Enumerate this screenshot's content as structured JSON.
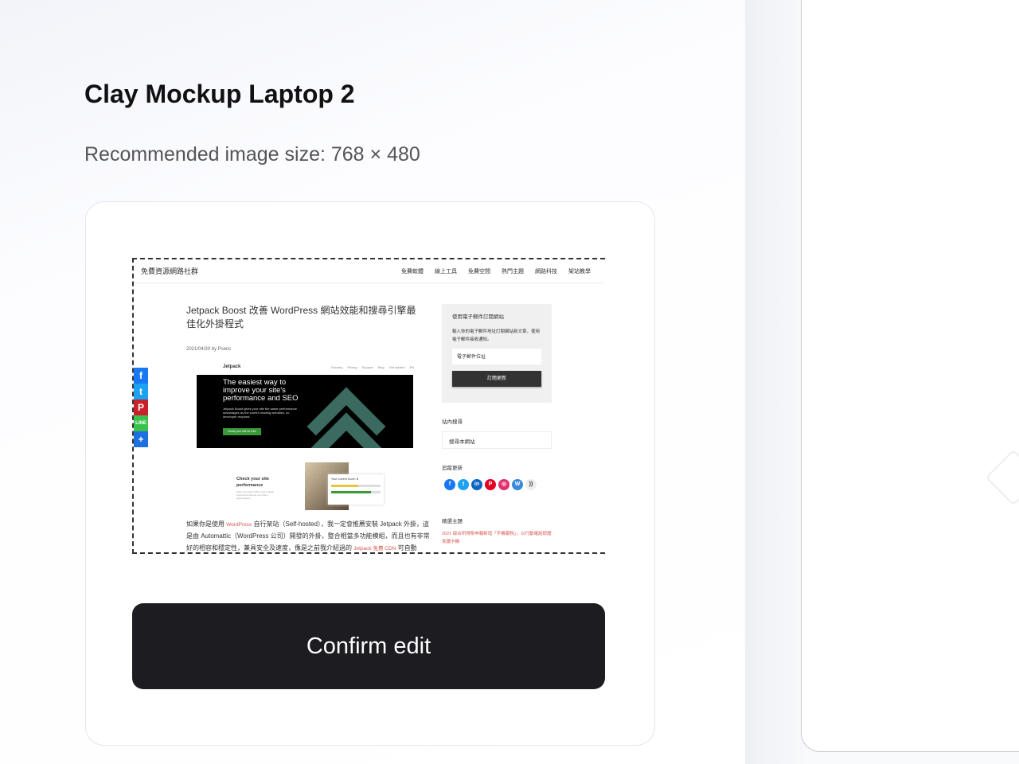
{
  "header": {
    "title": "Clay Mockup Laptop 2",
    "recommended": "Recommended image size: 768 × 480"
  },
  "preview": {
    "site_name": "免費資源網路社群",
    "nav": [
      "免費軟體",
      "線上工具",
      "免費空間",
      "熱門主題",
      "網路科技",
      "架站教學"
    ],
    "post_title": "Jetpack Boost 改善 WordPress 網站效能和搜尋引擎最佳化外掛程式",
    "meta": "2021/04/30 by Pseric",
    "jetpack": {
      "logo": "Jetpack",
      "nav": [
        "Security",
        "Pricing",
        "Support",
        "Blog",
        "Get started",
        "EN"
      ],
      "hero_title": "The easiest way to improve your site's performance and SEO",
      "hero_desc": "Jetpack Boost gives your site the same performance advantages as the world's leading websites, no developer required.",
      "hero_button": "Boost your site for free",
      "perf_title": "Check your site performance",
      "perf_desc": "Enter your site's URL to get a quick report and improve your site's performance.",
      "score_title": "Your Current Score: B"
    },
    "para": {
      "p1": "如果你是使用 ",
      "wp": "WordPress",
      "p2": " 自行架站（Self-hosted），我一定會推薦安裝 Jetpack 外掛，這是由 Automattic（WordPress 公司）開發的外掛，整合相當多功能模組，而且也有非常好的相容和穩定性，兼具安全及速度，像是之前我介紹過的 ",
      "cdn": "Jetpack 免費 CDN",
      "p3": " 可自動"
    },
    "subscribe": {
      "title": "使用電子郵件訂閱網站",
      "desc": "輸入你的電子郵件地址訂閱網站新文章，使用電子郵件接收通知。",
      "placeholder": "電子郵件位址",
      "button": "訂閱更新"
    },
    "search": {
      "title": "站內搜尋",
      "placeholder": "搜尋本網站"
    },
    "follow": {
      "title": "追蹤更新",
      "icons": [
        "facebook",
        "twitter",
        "linkedin",
        "pinterest",
        "instagram",
        "wordpress",
        "rss"
      ]
    },
    "featured": {
      "title": "精選主題",
      "link": "2021 綜合所得稅申報新增「手機報稅」，以行動電話認證免讀卡機"
    },
    "share": [
      "facebook",
      "twitter",
      "pinterest",
      "line",
      "more"
    ]
  },
  "confirm_button": "Confirm edit",
  "colors": {
    "button": "#1c1c21",
    "accent_red": "#d9534f",
    "jetpack_green": "#3a9a3a"
  }
}
